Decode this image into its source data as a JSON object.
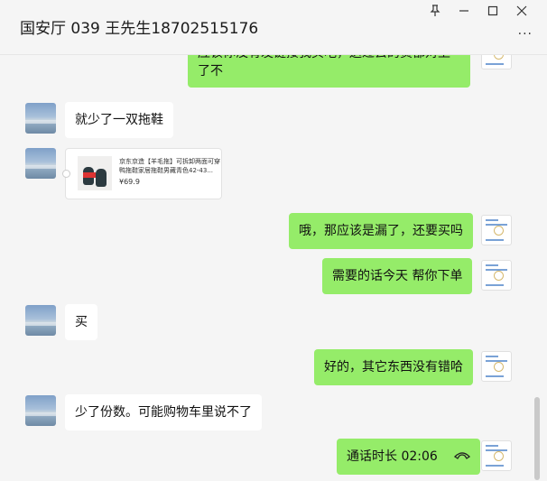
{
  "header": {
    "title": "国安厅 039 王先生18702515176",
    "pin_icon": "pin-icon",
    "more_label": "···"
  },
  "messages": [
    {
      "side": "right",
      "text": "应该你没有发链接我买吧，送过去的货都对上了不"
    },
    {
      "side": "left",
      "text": "就少了一双拖鞋"
    },
    {
      "side": "left",
      "type": "product_card",
      "desc": "京东京造【羊毛拖】可拆卸两面可穿鸭拖鞋家居拖鞋男藏青色42-43...",
      "price": "¥69.9"
    },
    {
      "side": "right",
      "text": "哦，那应该是漏了，还要买吗"
    },
    {
      "side": "right",
      "text": "需要的话今天 帮你下单"
    },
    {
      "side": "left",
      "text": "买"
    },
    {
      "side": "right",
      "text": "好的，其它东西没有错哈"
    },
    {
      "side": "left",
      "text": "少了份数。可能购物车里说不了"
    },
    {
      "side": "right",
      "type": "call",
      "text": "通话时长 02:06",
      "icon": "phone-hangup-icon"
    }
  ]
}
